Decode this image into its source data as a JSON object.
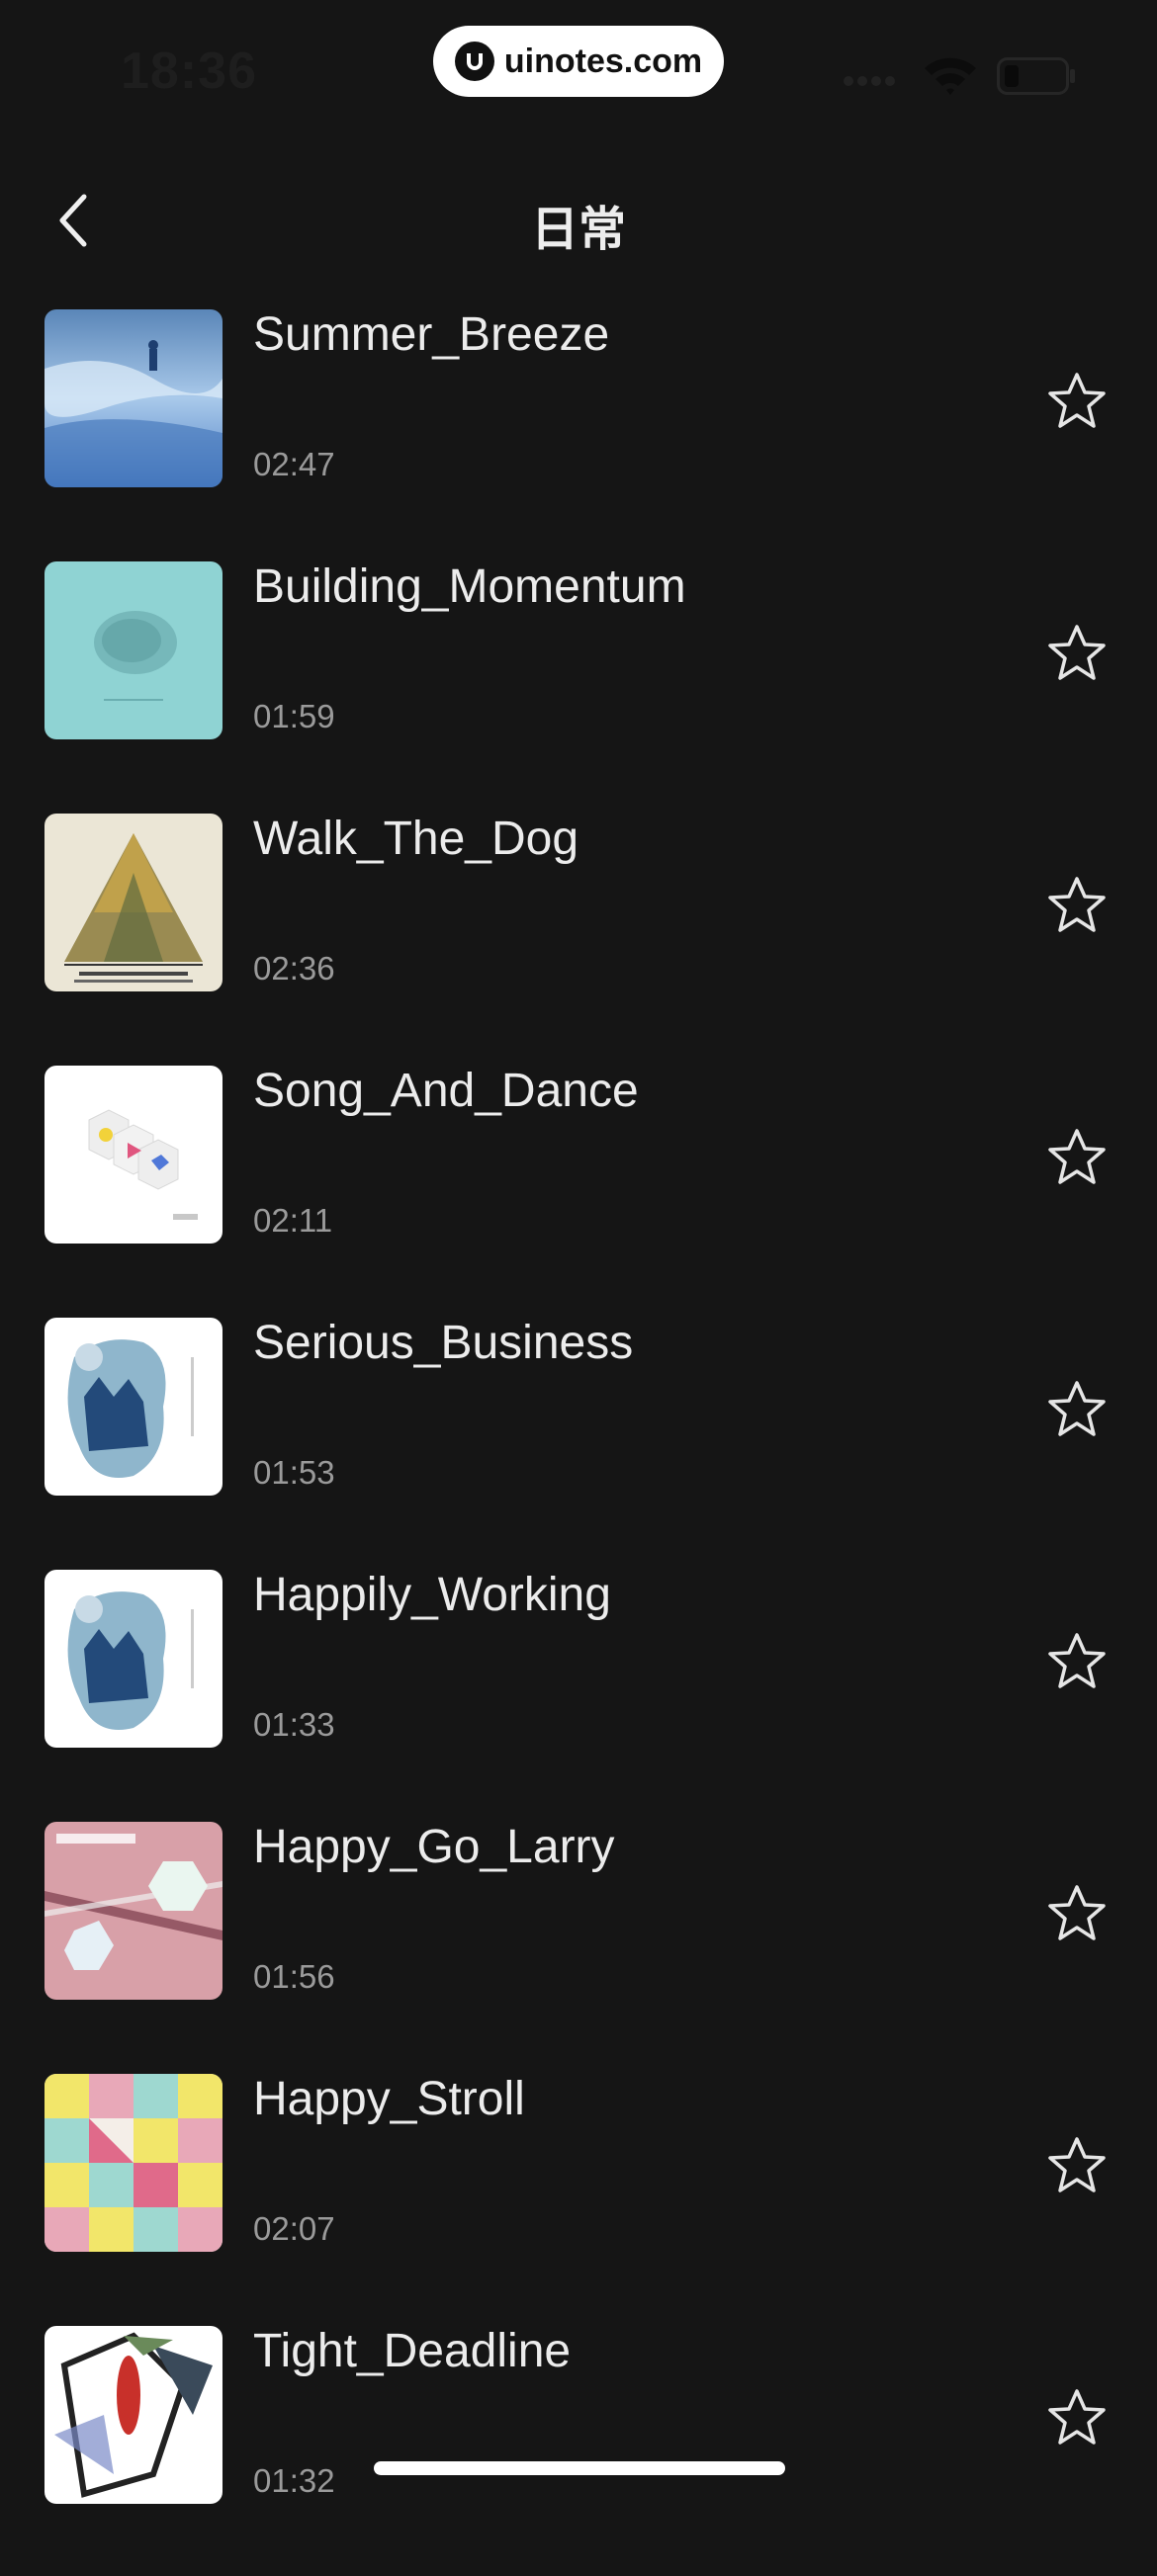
{
  "status_bar": {
    "time": "18:36",
    "watermark": "uinotes.com"
  },
  "header": {
    "title": "日常"
  },
  "tracks": [
    {
      "title": "Summer_Breeze",
      "duration": "02:47"
    },
    {
      "title": "Building_Momentum",
      "duration": "01:59"
    },
    {
      "title": "Walk_The_Dog",
      "duration": "02:36"
    },
    {
      "title": "Song_And_Dance",
      "duration": "02:11"
    },
    {
      "title": "Serious_Business",
      "duration": "01:53"
    },
    {
      "title": "Happily_Working",
      "duration": "01:33"
    },
    {
      "title": "Happy_Go_Larry",
      "duration": "01:56"
    },
    {
      "title": "Happy_Stroll",
      "duration": "02:07"
    },
    {
      "title": "Tight_Deadline",
      "duration": "01:32"
    }
  ],
  "icons": {
    "back": "chevron-left-icon",
    "favorite": "star-outline-icon"
  },
  "colors": {
    "background": "#151515",
    "text": "#ececec",
    "secondary_text": "#9a9a9a"
  }
}
